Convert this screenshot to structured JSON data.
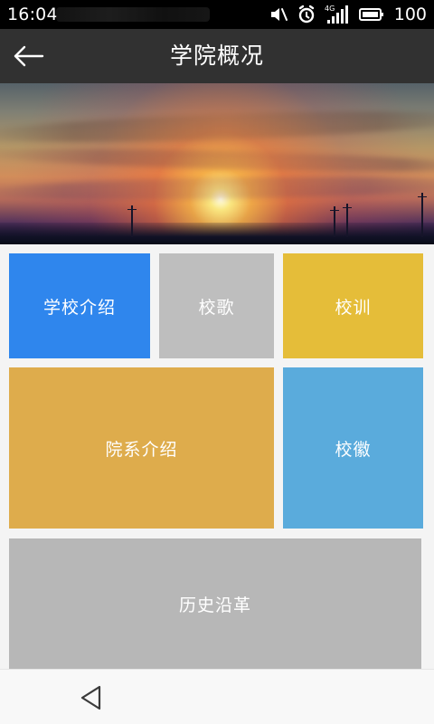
{
  "status_bar": {
    "time": "16:04",
    "network": "4G",
    "battery": "100",
    "icons": [
      "mute-icon",
      "alarm-icon",
      "signal-icon",
      "battery-icon"
    ]
  },
  "header": {
    "title": "学院概况",
    "back_icon": "arrow-left-icon"
  },
  "banner": {
    "image": "sunset-banner"
  },
  "tiles": [
    {
      "label": "学校介绍",
      "color": "#2f86ed"
    },
    {
      "label": "校歌",
      "color": "#bebebe"
    },
    {
      "label": "校训",
      "color": "#e5bd39"
    },
    {
      "label": "院系介绍",
      "color": "#deac4c"
    },
    {
      "label": "校徽",
      "color": "#5aabdc"
    },
    {
      "label": "历史沿革",
      "color": "#b7b7b7"
    }
  ],
  "navigation": {
    "back_icon": "triangle-back-icon"
  }
}
